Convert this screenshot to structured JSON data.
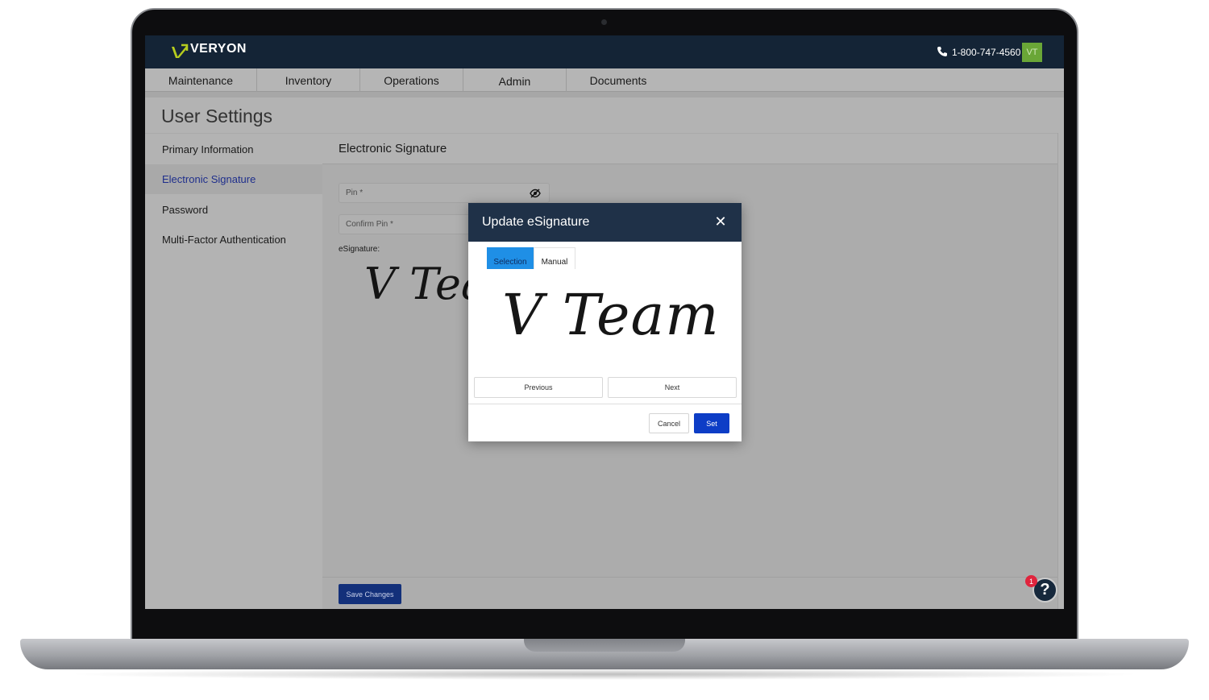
{
  "app": {
    "brand": "VERYON",
    "phone": "1-800-747-4560",
    "avatar_initials": "VT",
    "accent_color": "#6aa637",
    "header_color": "#142436"
  },
  "nav": {
    "items": [
      {
        "label": "Maintenance"
      },
      {
        "label": "Inventory"
      },
      {
        "label": "Operations"
      },
      {
        "label": "Admin"
      },
      {
        "label": "Documents"
      }
    ]
  },
  "page": {
    "title": "User Settings",
    "sidebar": [
      {
        "label": "Primary Information",
        "active": false
      },
      {
        "label": "Electronic Signature",
        "active": true
      },
      {
        "label": "Password",
        "active": false
      },
      {
        "label": "Multi-Factor Authentication",
        "active": false
      }
    ],
    "section_title": "Electronic Signature",
    "pin_placeholder": "Pin *",
    "confirm_pin_placeholder": "Confirm Pin *",
    "esignature_label": "eSignature:",
    "esignature_preview": "V Team",
    "save_label": "Save Changes"
  },
  "help": {
    "icon": "?",
    "badge_count": "1"
  },
  "modal": {
    "title": "Update eSignature",
    "close_icon": "close-icon",
    "tabs": [
      {
        "label": "Selection",
        "active": true
      },
      {
        "label": "Manual",
        "active": false
      }
    ],
    "signature": "V Team",
    "previous_label": "Previous",
    "next_label": "Next",
    "cancel_label": "Cancel",
    "set_label": "Set",
    "set_color": "#0d3dc6"
  }
}
